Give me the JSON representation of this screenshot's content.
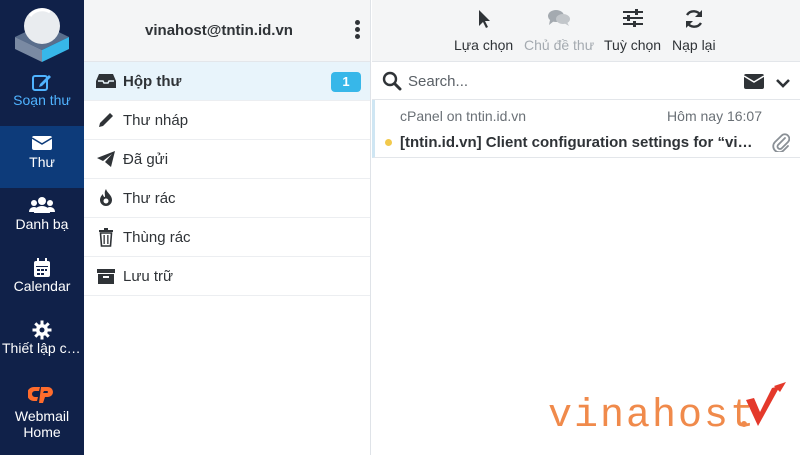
{
  "sidebar": {
    "items": [
      {
        "label": "Soạn thư",
        "icon": "compose-icon"
      },
      {
        "label": "Thư",
        "icon": "envelope-icon"
      },
      {
        "label": "Danh bạ",
        "icon": "contacts-icon"
      },
      {
        "label": "Calendar",
        "icon": "calendar-icon"
      },
      {
        "label": "Thiết lập cấu hình",
        "icon": "gear-icon"
      },
      {
        "label_line1": "Webmail",
        "label_line2": "Home",
        "icon": "cpanel-icon"
      }
    ]
  },
  "account": {
    "email": "vinahost@tntin.id.vn"
  },
  "folders": [
    {
      "label": "Hộp thư",
      "icon": "inbox-icon",
      "count": "1"
    },
    {
      "label": "Thư nháp",
      "icon": "pencil-icon"
    },
    {
      "label": "Đã gửi",
      "icon": "paper-plane-icon"
    },
    {
      "label": "Thư rác",
      "icon": "fire-icon"
    },
    {
      "label": "Thùng rác",
      "icon": "trash-icon"
    },
    {
      "label": "Lưu trữ",
      "icon": "archive-icon"
    }
  ],
  "toolbar": {
    "select": "Lựa chọn",
    "threads": "Chủ đề thư",
    "options": "Tuỳ chọn",
    "refresh": "Nạp lại"
  },
  "search": {
    "placeholder": "Search..."
  },
  "messages": [
    {
      "from": "cPanel on tntin.id.vn",
      "date": "Hôm nay 16:07",
      "subject": "[tntin.id.vn] Client configuration settings for “vinahost@tntin.id.vn”",
      "has_attachment": true,
      "unread": true
    }
  ],
  "watermark": {
    "text": "vinahost"
  },
  "colors": {
    "rail_bg": "#102149",
    "rail_active": "#0d3b7a",
    "accent": "#37b7e9",
    "compose": "#4fb3ff",
    "cpanel": "#ff6c2c",
    "watermark": "#f08a4b",
    "unread_dot": "#f2c94c"
  }
}
